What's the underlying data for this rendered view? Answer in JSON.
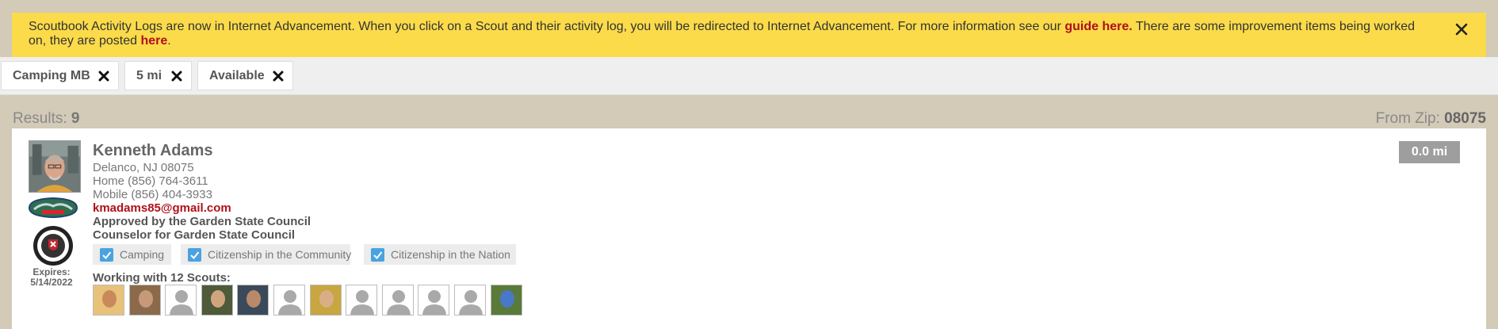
{
  "banner": {
    "text_before": "Scoutbook Activity Logs are now in Internet Advancement. When you click on a Scout and their activity log, you will be redirected to Internet Advancement. For more information see our ",
    "guide_link": "guide here.",
    "text_middle": " There are some improvement items being worked on, they are posted ",
    "here_link": "here",
    "text_after": ".",
    "close_icon": "close-icon"
  },
  "filters": [
    {
      "label": "Camping MB",
      "icon": "remove-icon"
    },
    {
      "label": "5 mi",
      "icon": "remove-icon"
    },
    {
      "label": "Available",
      "icon": "remove-icon"
    }
  ],
  "results": {
    "label": "Results: ",
    "count": "9"
  },
  "zip": {
    "label": "From Zip: ",
    "value": "08075"
  },
  "counselor": {
    "name": "Kenneth Adams",
    "location": "Delanco, NJ 08075",
    "home": "Home (856) 764-3611",
    "mobile": "Mobile (856) 404-3933",
    "email": "kmadams85@gmail.com",
    "approved": "Approved by the Garden State Council",
    "counselor_for": "Counselor for Garden State Council",
    "distance": "0.0 mi",
    "expires_label": "Expires:",
    "expires_date": "5/14/2022",
    "merit_badges": [
      "Camping",
      "Citizenship in the Community",
      "Citizenship in the Nation"
    ],
    "working_with": "Working with 12 Scouts:",
    "scouts": [
      "photo",
      "photo",
      "default",
      "photo",
      "photo",
      "default",
      "photo",
      "default",
      "default",
      "default",
      "default",
      "photo"
    ]
  },
  "colors": {
    "banner": "#fbdb4a",
    "link": "#b0101b",
    "checkbox": "#4aa3e0",
    "distance_badge": "#9e9e9e"
  }
}
